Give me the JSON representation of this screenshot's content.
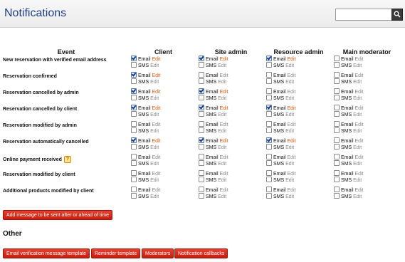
{
  "header": {
    "title": "Notifications",
    "search_placeholder": ""
  },
  "columns": [
    "Event",
    "Client",
    "Site admin",
    "Resource admin",
    "Main moderator"
  ],
  "labels": {
    "email": "Email",
    "sms": "SMS",
    "edit": "Edit"
  },
  "rows": [
    {
      "event": "New reservation with verified email address",
      "email": [
        true,
        true,
        true,
        false
      ],
      "sms": [
        false,
        false,
        false,
        false
      ]
    },
    {
      "event": "Reservation confirmed",
      "email": [
        true,
        false,
        false,
        false
      ],
      "sms": [
        false,
        false,
        false,
        false
      ]
    },
    {
      "event": "Reservation cancelled by admin",
      "email": [
        true,
        true,
        false,
        false
      ],
      "sms": [
        false,
        false,
        false,
        false
      ]
    },
    {
      "event": "Reservation cancelled by client",
      "email": [
        true,
        true,
        true,
        false
      ],
      "sms": [
        false,
        false,
        false,
        false
      ]
    },
    {
      "event": "Reservation modified by admin",
      "email": [
        false,
        false,
        false,
        false
      ],
      "sms": [
        false,
        false,
        false,
        false
      ]
    },
    {
      "event": "Reservation automatically cancelled",
      "email": [
        true,
        true,
        true,
        false
      ],
      "sms": [
        false,
        false,
        false,
        false
      ]
    },
    {
      "event": "Online payment received",
      "help": "?",
      "email": [
        false,
        false,
        false,
        false
      ],
      "sms": [
        false,
        false,
        false,
        false
      ]
    },
    {
      "event": "Reservation modified by client",
      "email": [
        false,
        false,
        false,
        false
      ],
      "sms": [
        false,
        false,
        false,
        false
      ]
    },
    {
      "event": "Additional products modified by client",
      "email": [
        false,
        false,
        false,
        false
      ],
      "sms": [
        false,
        false,
        false,
        false
      ]
    }
  ],
  "actions": {
    "add_message": "Add message to be sent after or ahead of time",
    "other_title": "Other",
    "email_verification": "Email verification message template",
    "reminder": "Reminder template",
    "moderators": "Moderators",
    "callbacks": "Notification callbacks"
  },
  "colors": {
    "title": "#1f3f86",
    "button": "#d6291a",
    "edit_active": "#e05a0d",
    "edit_inactive": "#8a8a8a"
  },
  "icons": {
    "search": "magnifier-icon",
    "help": "question-icon"
  }
}
